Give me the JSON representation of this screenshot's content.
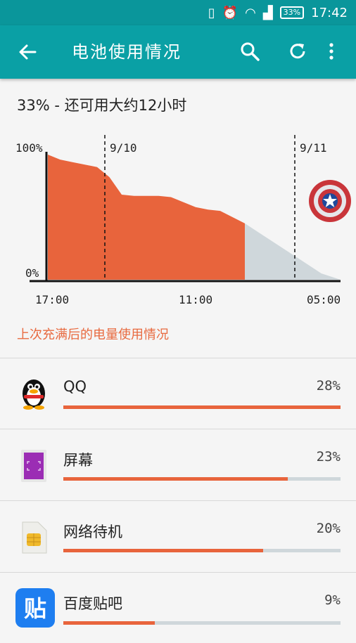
{
  "status_bar": {
    "time": "17:42",
    "battery": "33%"
  },
  "app_bar": {
    "title": "电池使用情况",
    "back_icon": "arrow-left-icon",
    "search_icon": "search-icon",
    "refresh_icon": "refresh-icon",
    "more_icon": "more-vert-icon"
  },
  "summary": "33% - 还可用大约12小时",
  "chart_data": {
    "type": "area",
    "title": "",
    "y_labels": [
      "100%",
      "0%"
    ],
    "x_labels": [
      "17:00",
      "11:00",
      "05:00"
    ],
    "date_markers": [
      "9/10",
      "9/11"
    ],
    "series": [
      {
        "name": "",
        "values": [
          100,
          96,
          94,
          92,
          90,
          82,
          68,
          67,
          67,
          67,
          66,
          62,
          58,
          56,
          55,
          50,
          45
        ]
      },
      {
        "name": "",
        "values": [
          45,
          35,
          25,
          15,
          5,
          0
        ]
      }
    ],
    "ylim": [
      0,
      100
    ],
    "colors": {
      "used": "#e8643c",
      "projected": "#cfd7db"
    }
  },
  "section_label": "上次充满后的电量使用情况",
  "apps": [
    {
      "name": "QQ",
      "percent_text": "28%",
      "fill": 1.0,
      "icon": "qq-penguin-icon"
    },
    {
      "name": "屏幕",
      "percent_text": "23%",
      "fill": 0.81,
      "icon": "screen-icon"
    },
    {
      "name": "网络待机",
      "percent_text": "20%",
      "fill": 0.72,
      "icon": "sim-card-icon"
    },
    {
      "name": "百度贴吧",
      "percent_text": "9%",
      "fill": 0.33,
      "icon": "tieba-icon"
    }
  ]
}
